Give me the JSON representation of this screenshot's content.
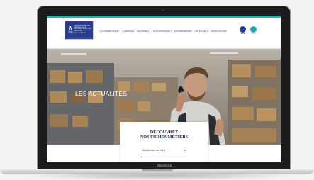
{
  "device": {
    "brand_label": "MacBook"
  },
  "site": {
    "logo_text": "OBSERVATOIRE DES METIERS DE LA DISTRIBUTION ET DES SERVICES AUTOMOBILES",
    "nav": [
      {
        "label": "QUI SOMMES-NOUS ?"
      },
      {
        "label": "LA BRANCHE"
      },
      {
        "label": "LES MÉTIERS ▾"
      },
      {
        "label": "LES STATISTIQUES ▾"
      },
      {
        "label": "NOS BAROMÈTRES"
      },
      {
        "label": "NOS ÉTUDES ▾"
      },
      {
        "label": "NOS ACTUALITÉS"
      }
    ],
    "badges": [
      {
        "label": "ANFA",
        "color": "#2a3d8f"
      },
      {
        "label": "OPCO",
        "color": "#2aa5b0"
      }
    ],
    "hero_title": "LES ACTUALITÉS",
    "card": {
      "title_line1": "DÉCOUVREZ",
      "title_line2": "NOS FICHES MÉTIERS",
      "select_placeholder": "Sélectionnez une fiche"
    }
  },
  "colors": {
    "brand_navy": "#2a3d8f",
    "accent_teal": "#3aa9a6"
  }
}
